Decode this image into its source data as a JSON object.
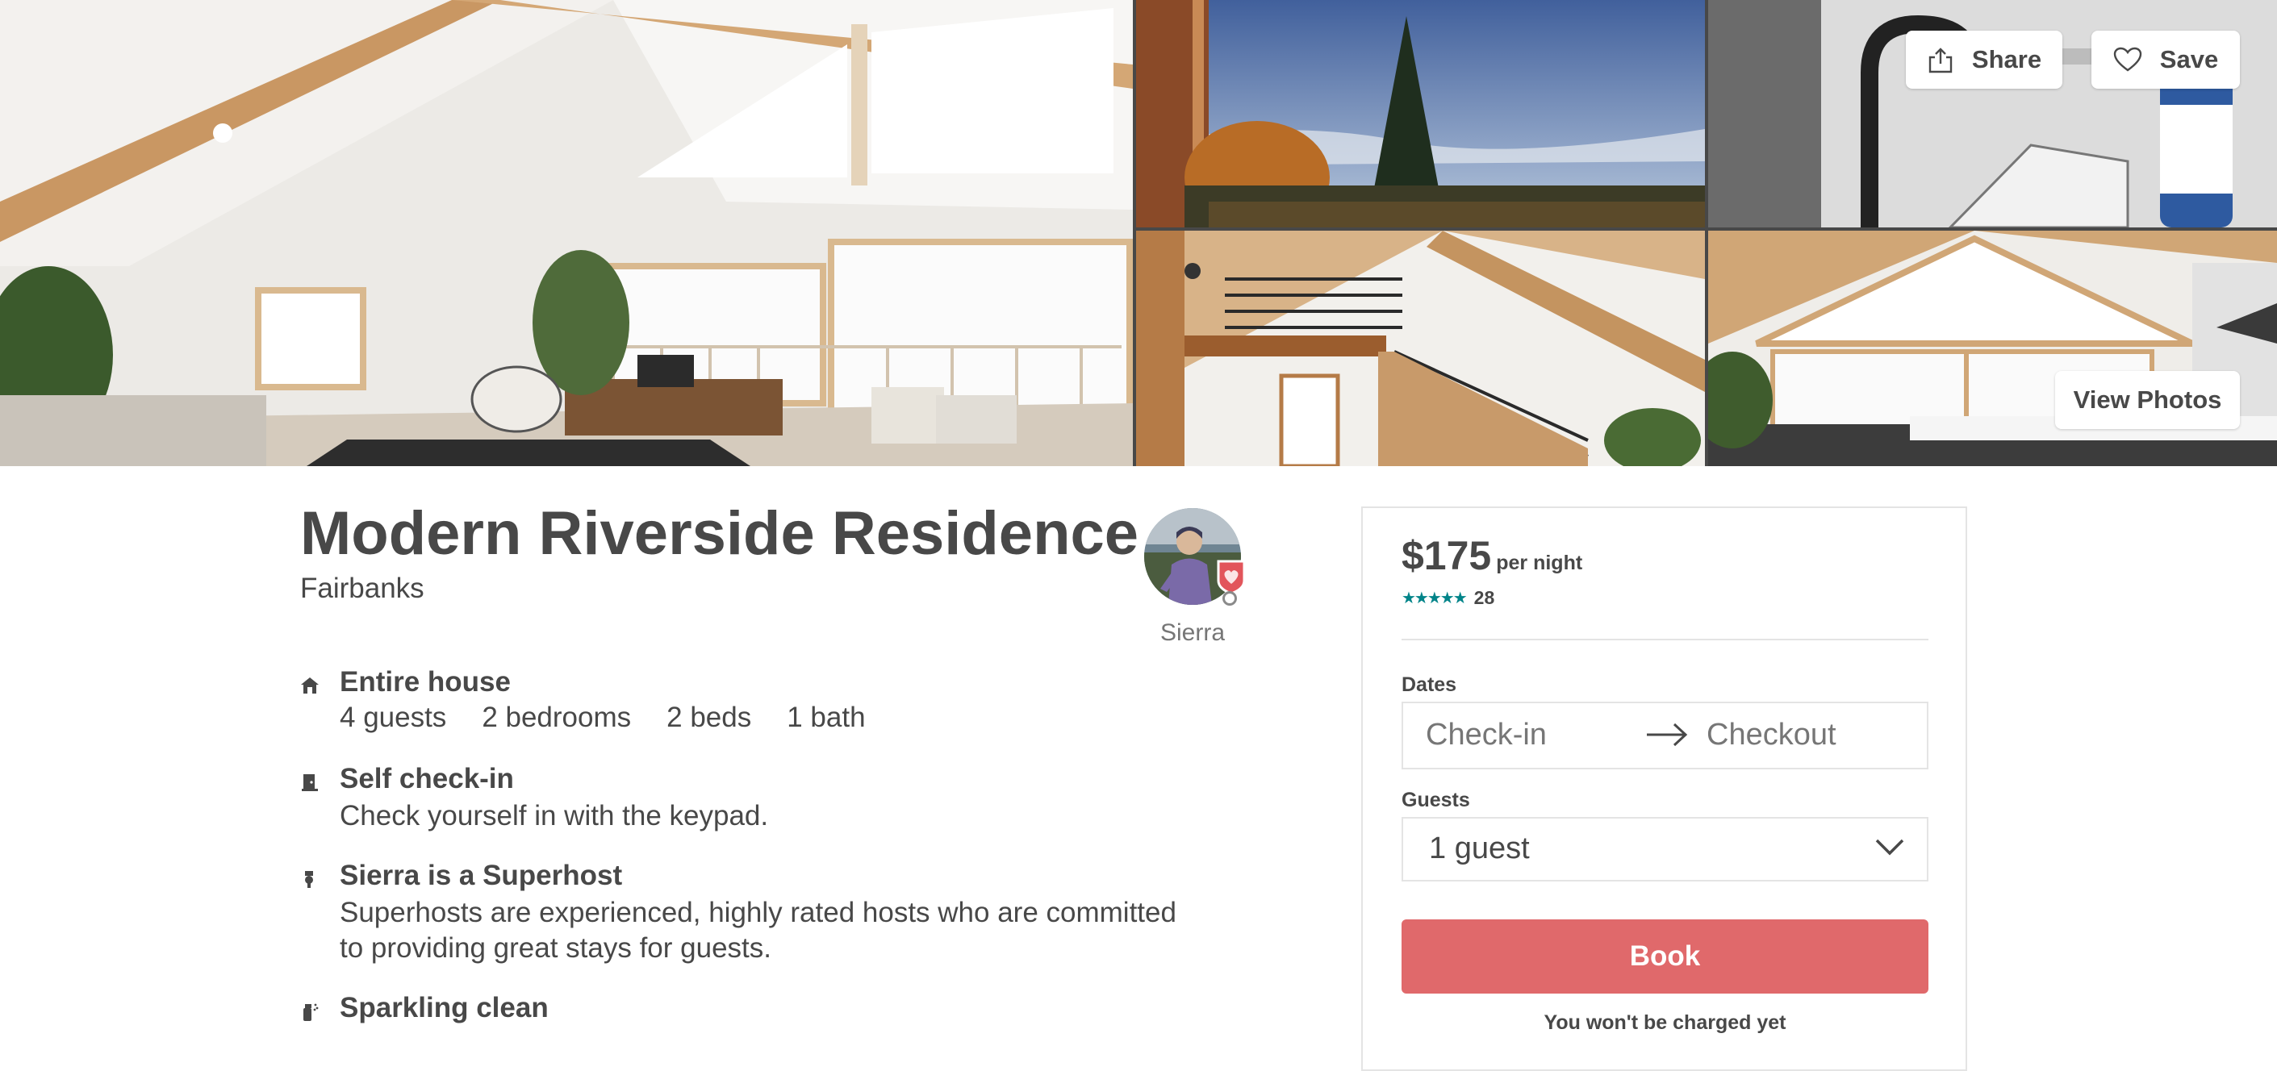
{
  "gallery": {
    "share_label": "Share",
    "save_label": "Save",
    "view_photos_label": "View Photos",
    "icons": {
      "share": "share-icon",
      "save": "heart-icon"
    }
  },
  "listing": {
    "title": "Modern Riverside Residence",
    "city": "Fairbanks",
    "host_name": "Sierra"
  },
  "features": [
    {
      "icon": "house-icon",
      "title": "Entire house",
      "stats": [
        "4 guests",
        "2 bedrooms",
        "2 beds",
        "1 bath"
      ]
    },
    {
      "icon": "door-icon",
      "title": "Self check-in",
      "description": "Check yourself in with the keypad."
    },
    {
      "icon": "medal-icon",
      "title": "Sierra is a Superhost",
      "description": "Superhosts are experienced, highly rated hosts who are committed to providing great stays for guests."
    },
    {
      "icon": "spray-icon",
      "title": "Sparkling clean"
    }
  ],
  "booking": {
    "price": "$175",
    "per_night": "per night",
    "stars": "★★★★★",
    "review_count": "28",
    "dates_label": "Dates",
    "checkin_placeholder": "Check-in",
    "checkout_placeholder": "Checkout",
    "guests_label": "Guests",
    "guests_value": "1 guest",
    "book_label": "Book",
    "charged_note": "You won't be charged yet"
  },
  "colors": {
    "text": "#484848",
    "muted": "#767676",
    "book": "#e0696b",
    "stars": "#008489",
    "border": "#e4e4e4"
  }
}
